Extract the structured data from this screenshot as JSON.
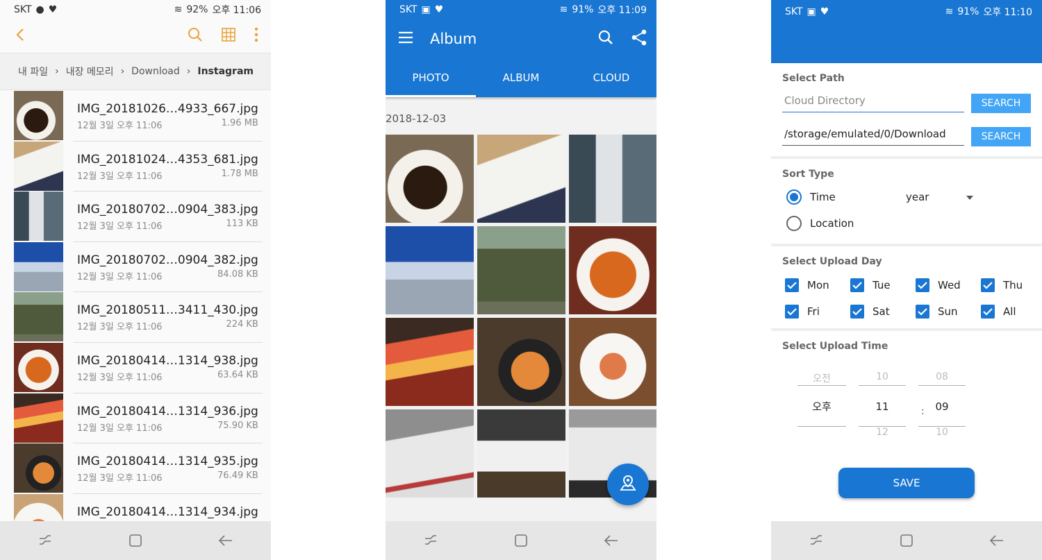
{
  "screen1": {
    "status": {
      "carrier": "SKT",
      "battery": "92%",
      "time": "오후 11:06"
    },
    "breadcrumbs": [
      "내 파일",
      "내장 메모리",
      "Download",
      "Instagram"
    ],
    "files": [
      {
        "name": "IMG_20181026…4933_667.jpg",
        "date": "12월 3일 오후 11:06",
        "size": "1.96 MB"
      },
      {
        "name": "IMG_20181024…4353_681.jpg",
        "date": "12월 3일 오후 11:06",
        "size": "1.78 MB"
      },
      {
        "name": "IMG_20180702…0904_383.jpg",
        "date": "12월 3일 오후 11:06",
        "size": "113 KB"
      },
      {
        "name": "IMG_20180702…0904_382.jpg",
        "date": "12월 3일 오후 11:06",
        "size": "84.08 KB"
      },
      {
        "name": "IMG_20180511…3411_430.jpg",
        "date": "12월 3일 오후 11:06",
        "size": "224 KB"
      },
      {
        "name": "IMG_20180414…1314_938.jpg",
        "date": "12월 3일 오후 11:06",
        "size": "63.64 KB"
      },
      {
        "name": "IMG_20180414…1314_936.jpg",
        "date": "12월 3일 오후 11:06",
        "size": "75.90 KB"
      },
      {
        "name": "IMG_20180414…1314_935.jpg",
        "date": "12월 3일 오후 11:06",
        "size": "76.49 KB"
      },
      {
        "name": "IMG_20180414…1314_934.jpg",
        "date": "",
        "size": ""
      }
    ]
  },
  "screen2": {
    "status": {
      "carrier": "SKT",
      "battery": "91%",
      "time": "오후 11:09"
    },
    "title": "Album",
    "tabs": [
      "PHOTO",
      "ALBUM",
      "CLOUD"
    ],
    "date": "2018-12-03"
  },
  "screen3": {
    "status": {
      "carrier": "SKT",
      "battery": "91%",
      "time": "오후 11:10"
    },
    "select_path": {
      "title": "Select Path",
      "cloud_placeholder": "Cloud Directory",
      "local_path": "/storage/emulated/0/Download",
      "search_label": "SEARCH"
    },
    "sort": {
      "title": "Sort Type",
      "options": [
        "Time",
        "Location"
      ],
      "selected": "Time",
      "dropdown_value": "year"
    },
    "upload_day": {
      "title": "Select Upload Day",
      "days": [
        "Mon",
        "Tue",
        "Wed",
        "Thu",
        "Fri",
        "Sat",
        "Sun",
        "All"
      ]
    },
    "upload_time": {
      "title": "Select Upload Time",
      "ampm": {
        "prev": "오전",
        "value": "오후",
        "next": ""
      },
      "hour": {
        "prev": "10",
        "value": "11",
        "next": "12"
      },
      "minute": {
        "prev": "08",
        "value": "09",
        "next": "10"
      },
      "separator": ":"
    },
    "save_label": "SAVE"
  },
  "colors": {
    "primary": "#1976d2",
    "accent_button": "#42a5f5",
    "file_manager_accent": "#e8a33a"
  }
}
